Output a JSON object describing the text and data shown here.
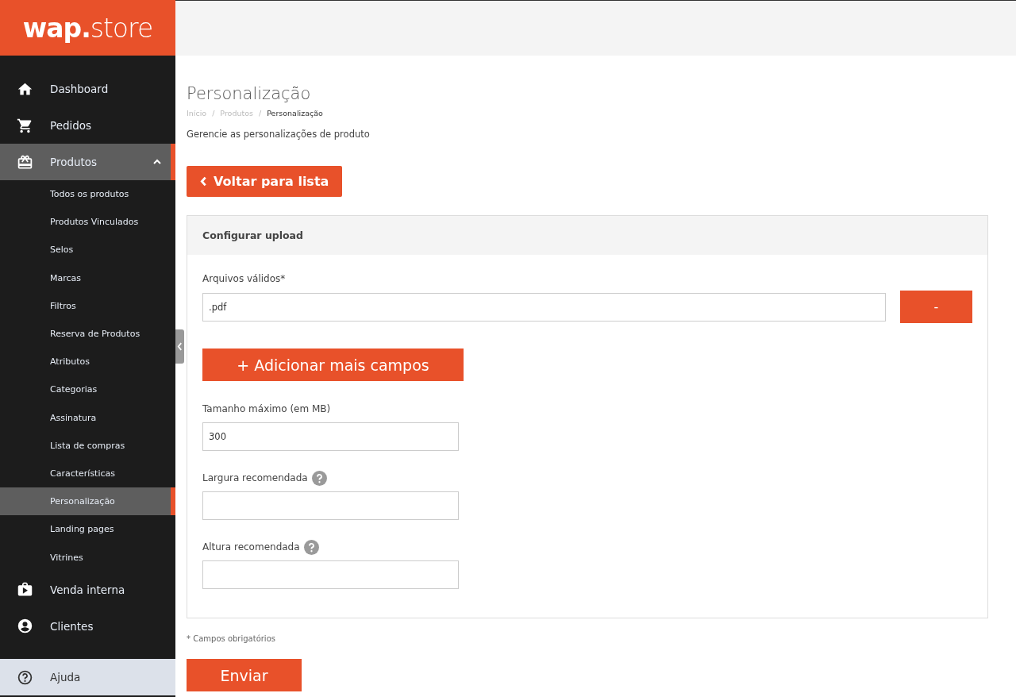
{
  "logo": "**wap.**store",
  "nav": [
    {
      "label": "Dashboard",
      "selected": false
    },
    {
      "label": "Pedidos",
      "selected": false
    },
    {
      "label": "Produtos",
      "selected": true,
      "expanded": true,
      "children": [
        {
          "label": "Todos os produtos",
          "selected": false
        },
        {
          "label": "Produtos Vinculados",
          "selected": false
        },
        {
          "label": "Selos",
          "selected": false
        },
        {
          "label": "Marcas",
          "selected": false
        },
        {
          "label": "Filtros",
          "selected": false
        },
        {
          "label": "Reserva de Produtos",
          "selected": false
        },
        {
          "label": "Atributos",
          "selected": false
        },
        {
          "label": "Categorias",
          "selected": false
        },
        {
          "label": "Assinatura",
          "selected": false
        },
        {
          "label": "Lista de compras",
          "selected": false
        },
        {
          "label": "Características",
          "selected": false
        },
        {
          "label": "Personalização",
          "selected": true
        },
        {
          "label": "Landing pages",
          "selected": false
        },
        {
          "label": "Vitrines",
          "selected": false
        }
      ]
    },
    {
      "label": "Venda interna",
      "selected": false
    },
    {
      "label": "Clientes",
      "selected": false
    }
  ],
  "help": {
    "label": "Ajuda"
  },
  "page": {
    "title": "Personalização",
    "breadcrumb": [
      "Início",
      "Produtos",
      "Personalização"
    ],
    "breadcrumb_separator": "/",
    "description": "Gerencie as personalizações de produto"
  },
  "back_button": "Voltar para lista",
  "panel": {
    "title": "Configurar upload",
    "items": [
      {
        "kind": "input-row",
        "label": "Arquivos válidos*",
        "value": ".pdf",
        "remove_button": "-"
      },
      {
        "kind": "add-button",
        "label": "+ Adicionar mais campos"
      },
      {
        "kind": "input",
        "label": "Tamanho máximo (em MB)",
        "value": "300",
        "help": false
      },
      {
        "kind": "input",
        "label": "Largura recomendada",
        "help": true
      },
      {
        "kind": "input",
        "label": "Altura recomendada",
        "help": true
      }
    ]
  },
  "required_note": "* Campos obrigatórios",
  "submit_button": "Enviar"
}
